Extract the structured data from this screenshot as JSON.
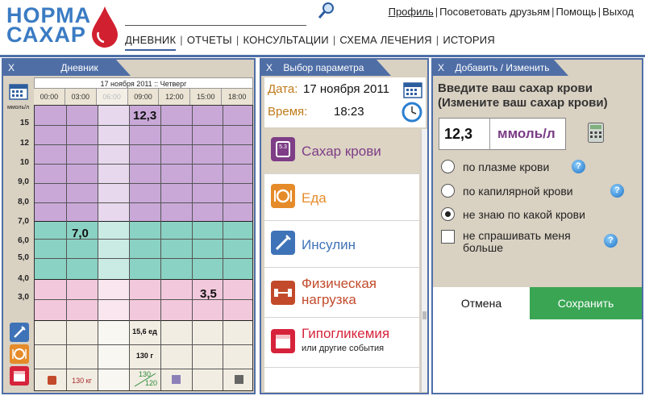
{
  "logo": {
    "line1": "НОРМА",
    "line2": "САХАР"
  },
  "search": {
    "value": "",
    "placeholder": ""
  },
  "toplinks": [
    "Профиль",
    "Посоветовать друзьям",
    "Помощь",
    "Выход"
  ],
  "nav": [
    "ДНЕВНИК",
    "ОТЧЕТЫ",
    "КОНСУЛЬТАЦИИ",
    "СХЕМА ЛЕЧЕНИЯ",
    "ИСТОРИЯ"
  ],
  "diary": {
    "close": "X",
    "title": "Дневник",
    "date": "17 ноября 2011 :: Четверг",
    "times": [
      "00:00",
      "03:00",
      "06:00",
      "09:00",
      "12:00",
      "15:00",
      "18:00"
    ],
    "unit": "ммоль/л",
    "y_labels": [
      "15",
      "12",
      "10",
      "9,0",
      "8,0",
      "7,0",
      "6,0",
      "5,0",
      "4,0",
      "3,0"
    ],
    "values": [
      {
        "text": "12,3",
        "time_index": 3
      },
      {
        "text": "7,0",
        "time_index": 1
      },
      {
        "text": "3,5",
        "time_index": 5
      }
    ],
    "insulin": "15,6 ед",
    "food": "130 г",
    "exercise": "130 кг",
    "pressure_top": "130",
    "pressure_bottom": "120",
    "colors": {
      "high": "#c9a8d8",
      "normal": "#8ad2c3",
      "low": "#f2c8dc",
      "events": "#f2ede2"
    }
  },
  "params": {
    "close": "X",
    "title": "Выбор параметра",
    "date_label": "Дата:",
    "date_value": "17 ноября 2011",
    "time_label": "Время:",
    "time_value": "18:23",
    "items": [
      {
        "name": "Сахар крови",
        "color": "#7e3d86",
        "icon": "glucometer-icon",
        "selected": true
      },
      {
        "name": "Еда",
        "color": "#e58b2a",
        "icon": "plate-icon"
      },
      {
        "name": "Инсулин",
        "color": "#3f73b8",
        "icon": "syringe-icon"
      },
      {
        "name": "Физическая нагрузка",
        "color": "#c24a2b",
        "icon": "dumbbell-icon"
      },
      {
        "name": "Гипогликемия",
        "sub": "или другие события",
        "color": "#d6233b",
        "icon": "calendar-icon"
      }
    ],
    "icon_text": "5.3"
  },
  "editor": {
    "close": "X",
    "title": "Добавить / Изменить",
    "question_line1": "Введите ваш сахар крови",
    "question_line2": "(Измените ваш сахар крови)",
    "value": "12,3",
    "unit": "ммоль/л",
    "options": [
      "по плазме крови",
      "по капилярной крови",
      "не знаю по какой крови"
    ],
    "selected_option": 2,
    "checkbox_line1": "не спрашивать меня",
    "checkbox_line2": "больше",
    "help": "?",
    "cancel": "Отмена",
    "save": "Сохранить"
  }
}
